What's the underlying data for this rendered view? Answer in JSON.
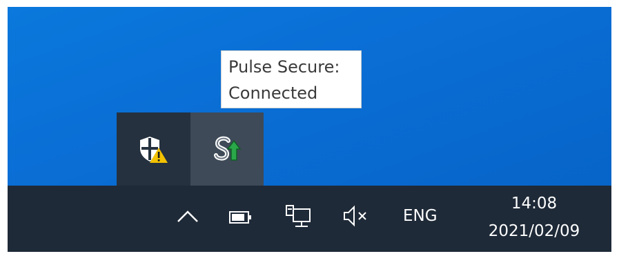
{
  "tooltip": {
    "line1": "Pulse Secure:",
    "line2": "Connected"
  },
  "tray_overflow": {
    "icons": [
      "windows-security-warning-icon",
      "pulse-secure-icon"
    ]
  },
  "taskbar": {
    "icons": [
      "chevron-up-icon",
      "battery-icon",
      "network-icon",
      "volume-muted-icon"
    ],
    "language": "ENG",
    "time": "14:08",
    "date": "2021/02/09"
  },
  "colors": {
    "desktop": "#0a6fd6",
    "taskbar": "#1f2a38",
    "overflow_panel": "#25313f",
    "hover_slot": "#3e4a58",
    "warning": "#f2c100",
    "pulse_green": "#2aa84a"
  }
}
